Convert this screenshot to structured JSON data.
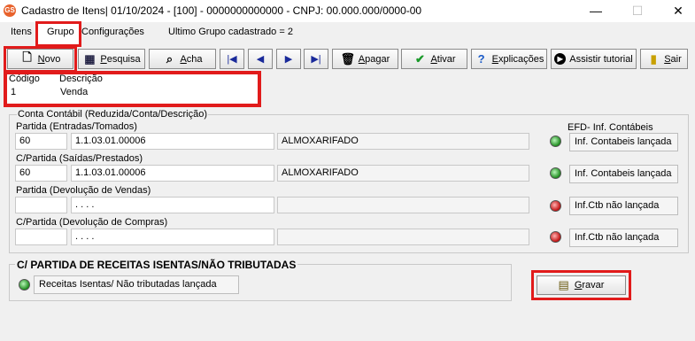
{
  "window": {
    "icon_text": "GS",
    "title": "Cadastro de Itens|  01/10/2024 - [100] - 0000000000000 - CNPJ: 00.000.000/0000-00",
    "min": "—",
    "max": "☐",
    "close": "✕"
  },
  "menu": {
    "itens": "Itens",
    "grupo": "Grupo",
    "configuracoes": "Configurações",
    "ultimo_grupo": "Ultimo Grupo cadastrado = 2"
  },
  "toolbar": {
    "novo": "Novo",
    "pesquisa": "Pesquisa",
    "acha": "Acha",
    "first": "|◀",
    "prev": "◀",
    "next": "▶",
    "last": "▶|",
    "apagar": "Apagar",
    "ativar": "Ativar",
    "explicacoes": "Explicações",
    "assistir_tutorial": "Assistir tutorial",
    "sair": "Sair"
  },
  "form": {
    "codigo_label": "Código",
    "descricao_label": "Descrição",
    "codigo_value": "1",
    "descricao_value": "Venda"
  },
  "conta_contabil": {
    "group_title": "Conta Contábil (Reduzida/Conta/Descrição)",
    "efd_title": "EFD- Inf. Contábeis",
    "rows": [
      {
        "label": "Partida (Entradas/Tomados)",
        "reduzida": "60",
        "conta": "1.1.03.01.00006",
        "descricao": "ALMOXARIFADO",
        "status": "green",
        "button": "Inf. Contabeis lançada"
      },
      {
        "label": "C/Partida (Saídas/Prestados)",
        "reduzida": "60",
        "conta": "1.1.03.01.00006",
        "descricao": "ALMOXARIFADO",
        "status": "green",
        "button": "Inf. Contabeis lançada"
      },
      {
        "label": "Partida (Devolução de Vendas)",
        "reduzida": "",
        "conta": ". . . .",
        "descricao": "",
        "status": "red",
        "button": "Inf.Ctb não lançada"
      },
      {
        "label": "C/Partida (Devolução de Compras)",
        "reduzida": "",
        "conta": ". . . .",
        "descricao": "",
        "status": "red",
        "button": "Inf.Ctb não lançada"
      }
    ]
  },
  "receitas": {
    "group_title": "C/ PARTIDA DE RECEITAS ISENTAS/NÃO TRIBUTADAS",
    "button": "Receitas Isentas/ Não tributadas lançada",
    "status": "green"
  },
  "gravar": "Gravar",
  "colors": {
    "highlight": "#e11b1b",
    "led_green": "#1e8c1e",
    "led_red": "#c01010"
  }
}
